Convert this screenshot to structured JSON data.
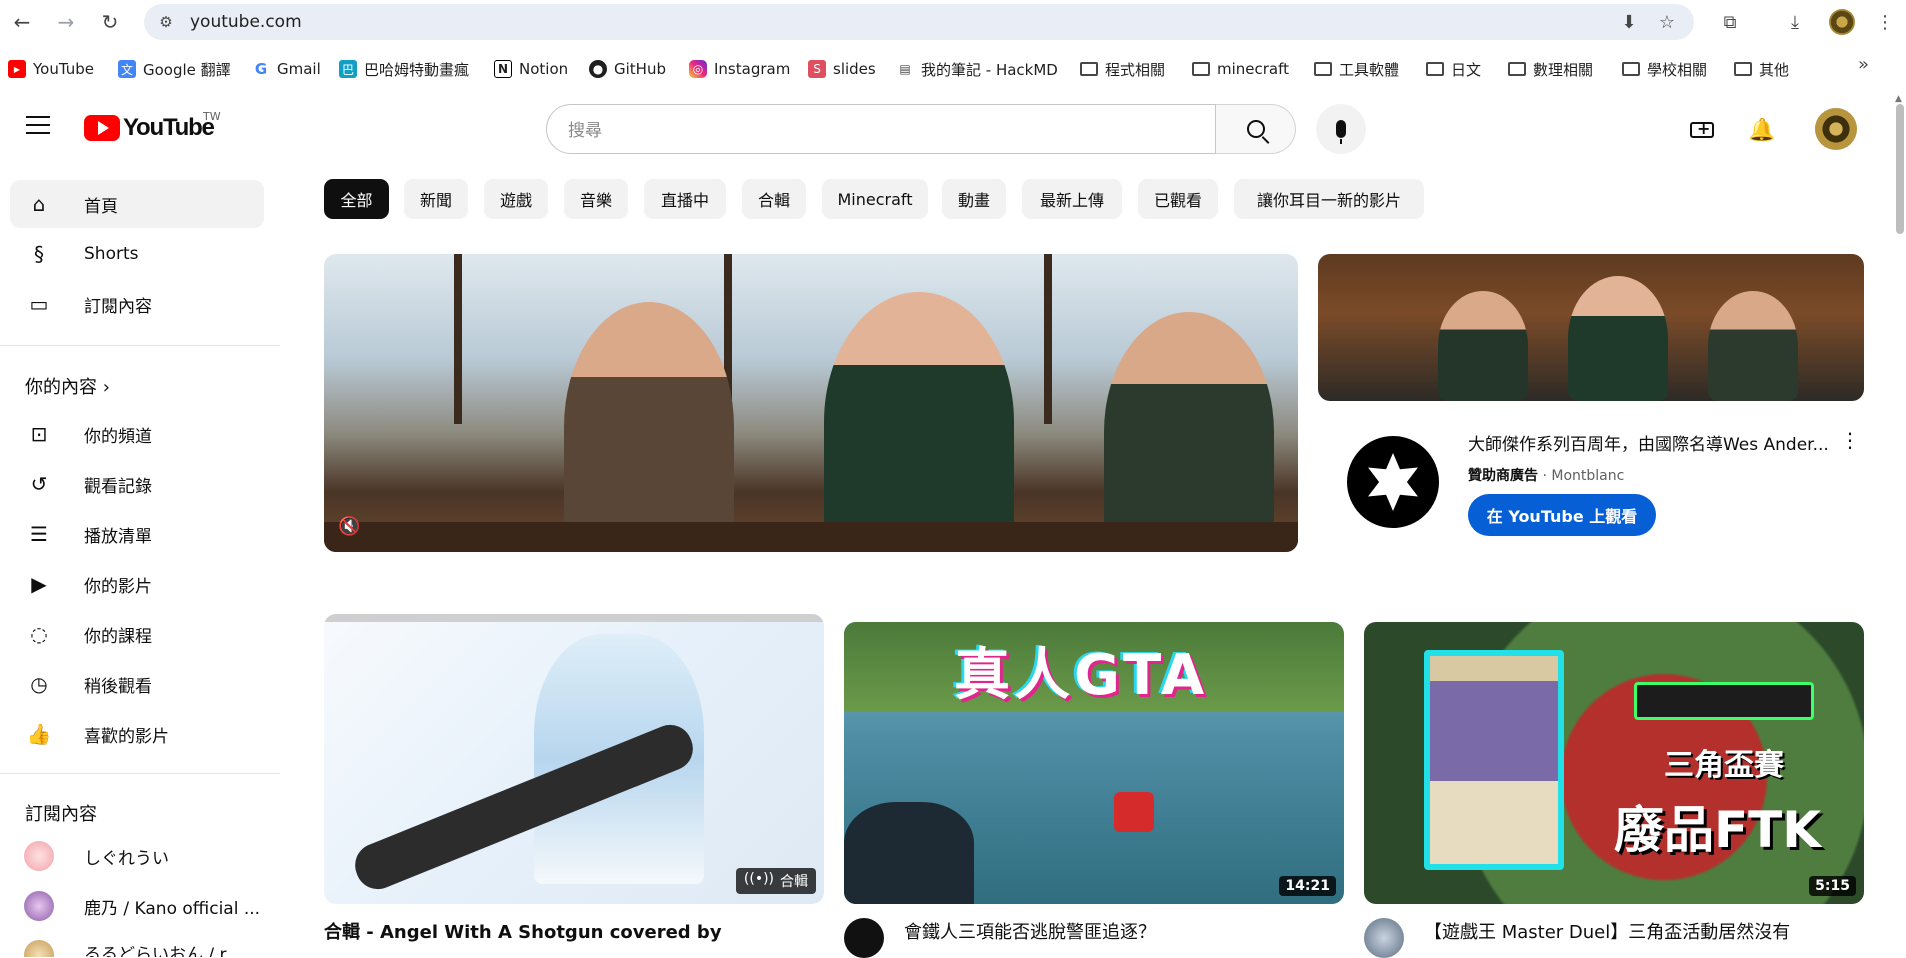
{
  "browser": {
    "url": "youtube.com",
    "bookmarks": [
      {
        "label": "YouTube",
        "icon": "youtube-icon"
      },
      {
        "label": "Google 翻譯",
        "icon": "google-translate-icon"
      },
      {
        "label": "Gmail",
        "icon": "google-icon"
      },
      {
        "label": "巴哈姆特動畫瘋",
        "icon": "bahamut-icon"
      },
      {
        "label": "Notion",
        "icon": "notion-icon"
      },
      {
        "label": "GitHub",
        "icon": "github-icon"
      },
      {
        "label": "Instagram",
        "icon": "instagram-icon"
      },
      {
        "label": "slides",
        "icon": "slides-icon"
      },
      {
        "label": "我的筆記 - HackMD",
        "icon": "document-icon"
      },
      {
        "label": "程式相關",
        "icon": "folder-icon"
      },
      {
        "label": "minecraft",
        "icon": "folder-icon"
      },
      {
        "label": "工具軟體",
        "icon": "folder-icon"
      },
      {
        "label": "日文",
        "icon": "folder-icon"
      },
      {
        "label": "數理相關",
        "icon": "folder-icon"
      },
      {
        "label": "學校相關",
        "icon": "folder-icon"
      },
      {
        "label": "其他",
        "icon": "folder-icon"
      }
    ],
    "more_glyph": "»"
  },
  "masthead": {
    "logo_text": "YouTube",
    "region": "TW",
    "search_placeholder": "搜尋"
  },
  "sidebar": {
    "main": [
      {
        "label": "首頁",
        "icon": "home-icon",
        "active": true
      },
      {
        "label": "Shorts",
        "icon": "shorts-icon"
      },
      {
        "label": "訂閱內容",
        "icon": "subscriptions-icon"
      }
    ],
    "you_heading": "你的內容",
    "you": [
      {
        "label": "你的頻道",
        "icon": "channel-icon"
      },
      {
        "label": "觀看記錄",
        "icon": "history-icon"
      },
      {
        "label": "播放清單",
        "icon": "playlist-icon"
      },
      {
        "label": "你的影片",
        "icon": "your-videos-icon"
      },
      {
        "label": "你的課程",
        "icon": "courses-icon"
      },
      {
        "label": "稍後觀看",
        "icon": "watch-later-icon"
      },
      {
        "label": "喜歡的影片",
        "icon": "liked-icon"
      }
    ],
    "subs_heading": "訂閱內容",
    "subs": [
      {
        "label": "しぐれうい"
      },
      {
        "label": "鹿乃 / Kano official ..."
      },
      {
        "label": "るるどらいおん / r"
      }
    ]
  },
  "chips": [
    "全部",
    "新聞",
    "遊戲",
    "音樂",
    "直播中",
    "合輯",
    "Minecraft",
    "動畫",
    "最新上傳",
    "已觀看",
    "讓你耳目一新的影片"
  ],
  "ad": {
    "title": "大師傑作系列百周年，由國際名導Wes Ander...",
    "sponsored": "贊助商廣告",
    "separator": "·",
    "advertiser": "Montblanc",
    "cta": "在 YouTube 上觀看"
  },
  "videos": [
    {
      "title": "合輯 - Angel With A Shotgun covered by",
      "badge": "合輯",
      "badge_icon": "broadcast-icon"
    },
    {
      "title": "會鐵人三項能否逃脫警匪追逐？",
      "duration": "14:21",
      "overlay_text": "真人GTA"
    },
    {
      "title": "【遊戲王 Master Duel】三角盃活動居然沒有",
      "duration": "5:15",
      "overlay_text_1": "三角盃賽",
      "overlay_text_2": "廢品FTK"
    }
  ],
  "colors": {
    "accent_red": "#ff0000",
    "cta_blue": "#065fd4",
    "chip_bg": "#f2f2f2",
    "chip_active_bg": "#0f0f0f"
  }
}
